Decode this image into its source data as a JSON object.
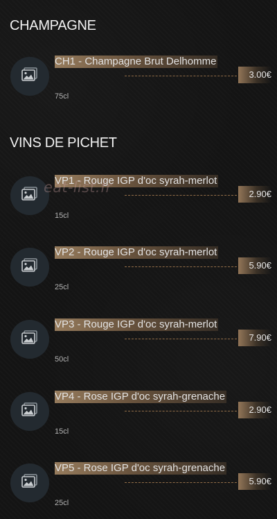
{
  "sections": [
    {
      "title": "CHAMPAGNE",
      "items": [
        {
          "name": "CH1 - Champagne Brut Delhomme",
          "price": "3.00€",
          "volume": "75cl"
        }
      ]
    },
    {
      "title": "VINS DE PICHET",
      "items": [
        {
          "name": "VP1 - Rouge IGP d'oc syrah-merlot",
          "price": "2.90€",
          "volume": "15cl"
        },
        {
          "name": "VP2 - Rouge IGP d'oc syrah-merlot",
          "price": "5.90€",
          "volume": "25cl"
        },
        {
          "name": "VP3 - Rouge IGP d'oc syrah-merlot",
          "price": "7.90€",
          "volume": "50cl"
        },
        {
          "name": "VP4 - Rose IGP d'oc syrah-grenache",
          "price": "2.90€",
          "volume": "15cl"
        },
        {
          "name": "VP5 - Rose IGP d'oc syrah-grenache",
          "price": "5.90€",
          "volume": "25cl"
        }
      ]
    }
  ],
  "placeholder_icon": "image-placeholder-icon",
  "watermark": "eat-list.fr",
  "colors": {
    "background": "#141414",
    "thumbnail": "#232a30",
    "highlight": "#a88a67",
    "leader": "#be8c5a"
  }
}
